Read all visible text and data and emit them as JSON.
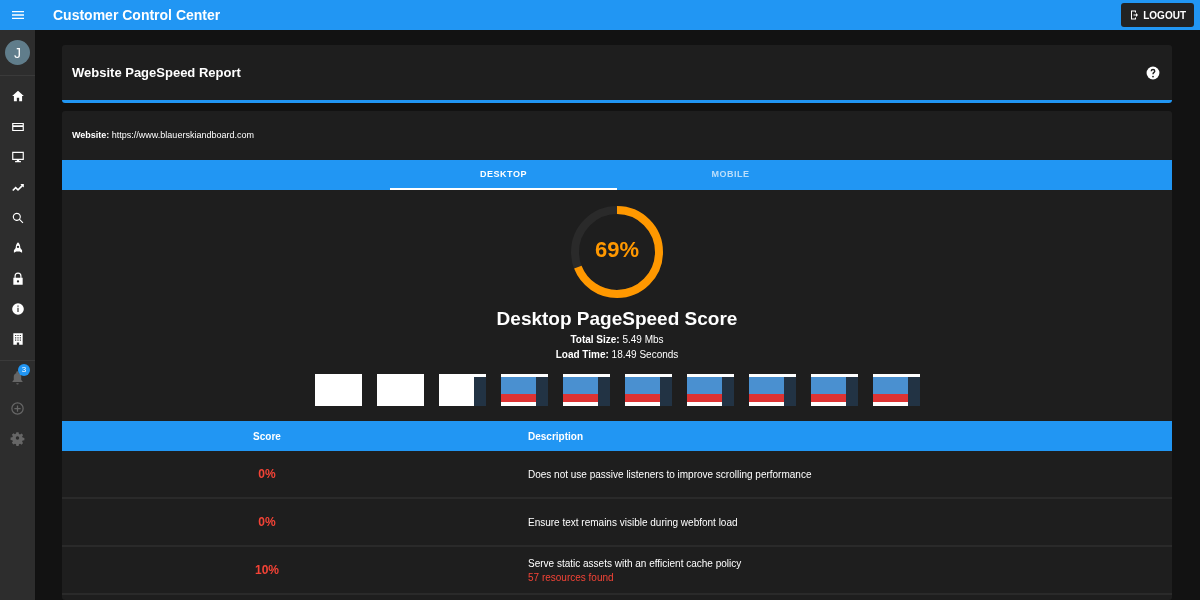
{
  "app_bar": {
    "title": "Customer Control Center",
    "logout_button": "LOGOUT"
  },
  "sidebar": {
    "avatar": "J",
    "items": [
      {
        "kind": "home",
        "disabled": false
      },
      {
        "kind": "card",
        "disabled": false
      },
      {
        "kind": "monitor",
        "disabled": false
      },
      {
        "kind": "trend",
        "disabled": false
      },
      {
        "kind": "search",
        "disabled": false
      },
      {
        "kind": "rocket",
        "disabled": false
      },
      {
        "kind": "lock",
        "disabled": false
      },
      {
        "kind": "info",
        "disabled": false
      },
      {
        "kind": "building",
        "disabled": false
      }
    ],
    "bottom_items": [
      {
        "kind": "bell",
        "disabled": true,
        "badge": "3"
      },
      {
        "kind": "plus",
        "disabled": true
      },
      {
        "kind": "gear",
        "disabled": true
      }
    ]
  },
  "report": {
    "title": "Website PageSpeed Report",
    "website_label": "Website:",
    "website": "https://www.blauerskiandboard.com"
  },
  "tabs": [
    {
      "label": "DESKTOP",
      "selected": true
    },
    {
      "label": "MOBILE",
      "selected": false
    }
  ],
  "score": {
    "value": "69%",
    "level": 0.69,
    "title": "Desktop PageSpeed Score",
    "total_size_label": "Total Size:",
    "total_size": "5.49 Mbs",
    "load_time_label": "Load Time:",
    "load_time": "18.49 Seconds"
  },
  "filmstrip": [
    {
      "kind": "blank"
    },
    {
      "kind": "blank"
    },
    {
      "kind": "partial"
    },
    {
      "kind": "page"
    },
    {
      "kind": "page"
    },
    {
      "kind": "page"
    },
    {
      "kind": "page"
    },
    {
      "kind": "page"
    },
    {
      "kind": "page"
    },
    {
      "kind": "page"
    }
  ],
  "table": {
    "columns": [
      "Score",
      "Description"
    ],
    "rows": [
      {
        "score": "0%",
        "description": "Does not use passive listeners to improve scrolling performance"
      },
      {
        "score": "0%",
        "description": "Ensure text remains visible during webfont load"
      },
      {
        "score": "10%",
        "description": "Serve static assets with an efficient cache policy",
        "detail": "57 resources found"
      }
    ]
  }
}
